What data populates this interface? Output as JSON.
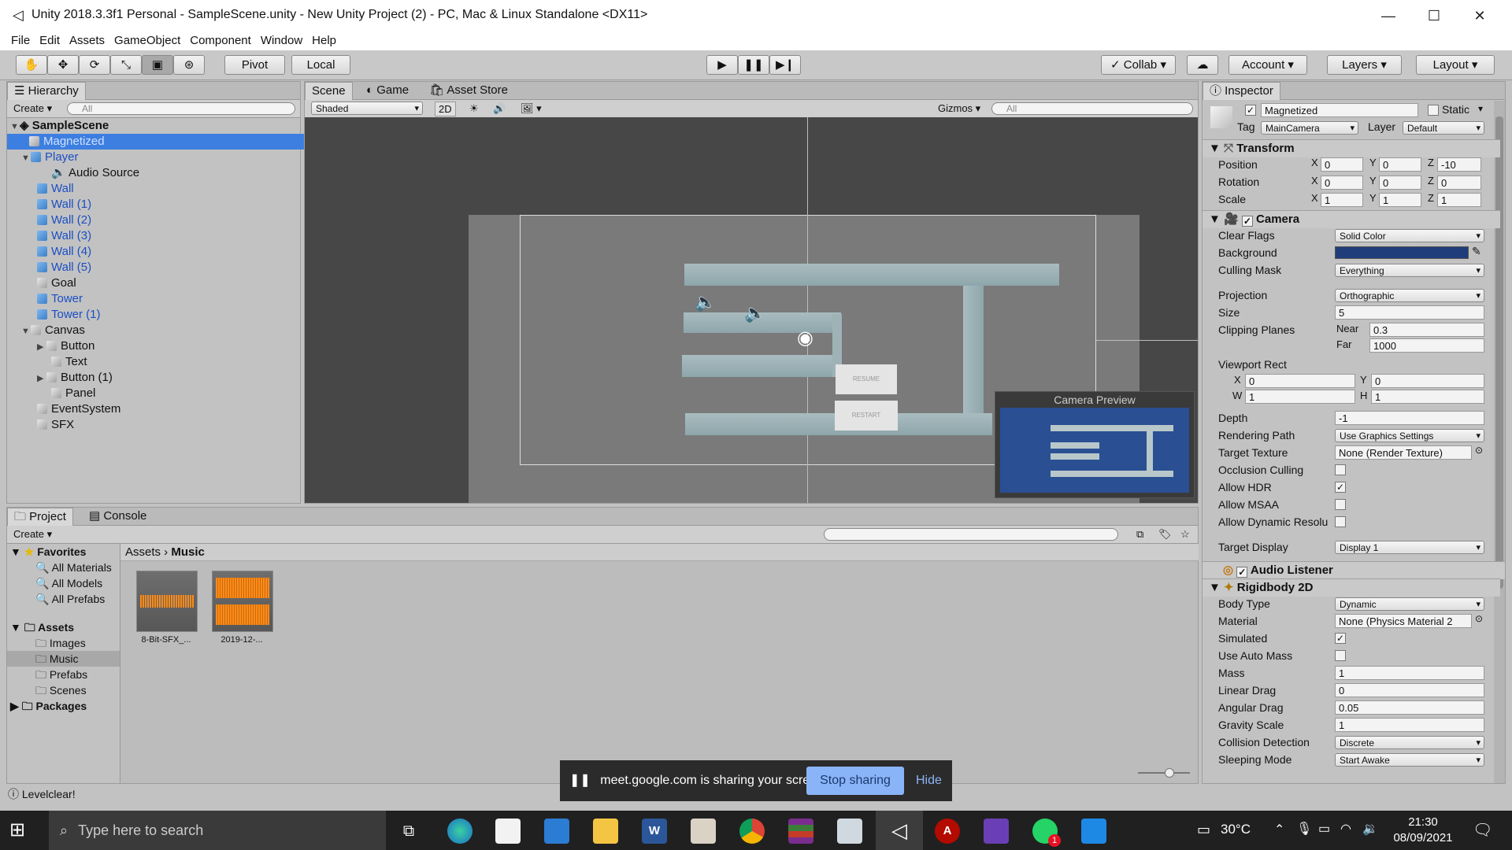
{
  "window": {
    "title": "Unity 2018.3.3f1 Personal - SampleScene.unity - New Unity Project (2) - PC, Mac & Linux Standalone <DX11>"
  },
  "menu": [
    "File",
    "Edit",
    "Assets",
    "GameObject",
    "Component",
    "Window",
    "Help"
  ],
  "toolbar": {
    "pivot": "Pivot",
    "local": "Local",
    "collab": "Collab",
    "account": "Account",
    "layers": "Layers",
    "layout": "Layout"
  },
  "hierarchy": {
    "tab": "Hierarchy",
    "create": "Create",
    "search_placeholder": "All",
    "scene": "SampleScene",
    "items": [
      {
        "label": "Magnetized"
      },
      {
        "label": "Player"
      },
      {
        "label": "Audio Source"
      },
      {
        "label": "Wall"
      },
      {
        "label": "Wall (1)"
      },
      {
        "label": "Wall (2)"
      },
      {
        "label": "Wall (3)"
      },
      {
        "label": "Wall (4)"
      },
      {
        "label": "Wall (5)"
      },
      {
        "label": "Goal"
      },
      {
        "label": "Tower"
      },
      {
        "label": "Tower (1)"
      },
      {
        "label": "Canvas"
      },
      {
        "label": "Button"
      },
      {
        "label": "Text"
      },
      {
        "label": "Button (1)"
      },
      {
        "label": "Panel"
      },
      {
        "label": "EventSystem"
      },
      {
        "label": "SFX"
      }
    ]
  },
  "scene": {
    "tabs": [
      "Scene",
      "Game",
      "Asset Store"
    ],
    "shading": "Shaded",
    "mode_2d": "2D",
    "gizmos": "Gizmos",
    "search_placeholder": "All",
    "resume": "RESUME",
    "restart": "RESTART",
    "camera_preview": "Camera Preview"
  },
  "project": {
    "tabs": [
      "Project",
      "Console"
    ],
    "create": "Create",
    "breadcrumb": [
      "Assets",
      "Music"
    ],
    "favorites_label": "Favorites",
    "favorites": [
      "All Materials",
      "All Models",
      "All Prefabs"
    ],
    "assets_label": "Assets",
    "asset_folders": [
      "Images",
      "Music",
      "Prefabs",
      "Scenes"
    ],
    "packages_label": "Packages",
    "files": [
      "8-Bit-SFX_...",
      "2019-12-..."
    ]
  },
  "inspector": {
    "tab": "Inspector",
    "object_name": "Magnetized",
    "static_label": "Static",
    "tag_label": "Tag",
    "tag": "MainCamera",
    "layer_label": "Layer",
    "layer": "Default",
    "transform": {
      "title": "Transform",
      "rows": [
        {
          "label": "Position",
          "x": "0",
          "y": "0",
          "z": "-10"
        },
        {
          "label": "Rotation",
          "x": "0",
          "y": "0",
          "z": "0"
        },
        {
          "label": "Scale",
          "x": "1",
          "y": "1",
          "z": "1"
        }
      ]
    },
    "camera": {
      "title": "Camera",
      "clear_flags_label": "Clear Flags",
      "clear_flags": "Solid Color",
      "background_label": "Background",
      "background_color": "#1f3d7a",
      "culling_mask_label": "Culling Mask",
      "culling_mask": "Everything",
      "projection_label": "Projection",
      "projection": "Orthographic",
      "size_label": "Size",
      "size": "5",
      "clipping_label": "Clipping Planes",
      "near_label": "Near",
      "near": "0.3",
      "far_label": "Far",
      "far": "1000",
      "viewport_label": "Viewport Rect",
      "vx": "0",
      "vy": "0",
      "vw": "1",
      "vh": "1",
      "depth_label": "Depth",
      "depth": "-1",
      "rendering_path_label": "Rendering Path",
      "rendering_path": "Use Graphics Settings",
      "target_texture_label": "Target Texture",
      "target_texture": "None (Render Texture)",
      "occlusion_label": "Occlusion Culling",
      "hdr_label": "Allow HDR",
      "msaa_label": "Allow MSAA",
      "dynres_label": "Allow Dynamic Resolu",
      "target_display_label": "Target Display",
      "target_display": "Display 1"
    },
    "audio_listener": "Audio Listener",
    "rigidbody": {
      "title": "Rigidbody 2D",
      "body_type_label": "Body Type",
      "body_type": "Dynamic",
      "material_label": "Material",
      "material": "None (Physics Material 2",
      "simulated_label": "Simulated",
      "auto_mass_label": "Use Auto Mass",
      "mass_label": "Mass",
      "mass": "1",
      "linear_drag_label": "Linear Drag",
      "linear_drag": "0",
      "angular_drag_label": "Angular Drag",
      "angular_drag": "0.05",
      "gravity_label": "Gravity Scale",
      "gravity": "1",
      "collision_label": "Collision Detection",
      "collision": "Discrete",
      "sleeping_label": "Sleeping Mode",
      "sleeping": "Start Awake"
    }
  },
  "status": "Levelclear!",
  "share": {
    "text": "meet.google.com is sharing your screen.",
    "stop": "Stop sharing",
    "hide": "Hide"
  },
  "taskbar": {
    "search_placeholder": "Type here to search",
    "temp": "30°C",
    "time": "21:30",
    "date": "08/09/2021",
    "chat_badge": "1"
  }
}
